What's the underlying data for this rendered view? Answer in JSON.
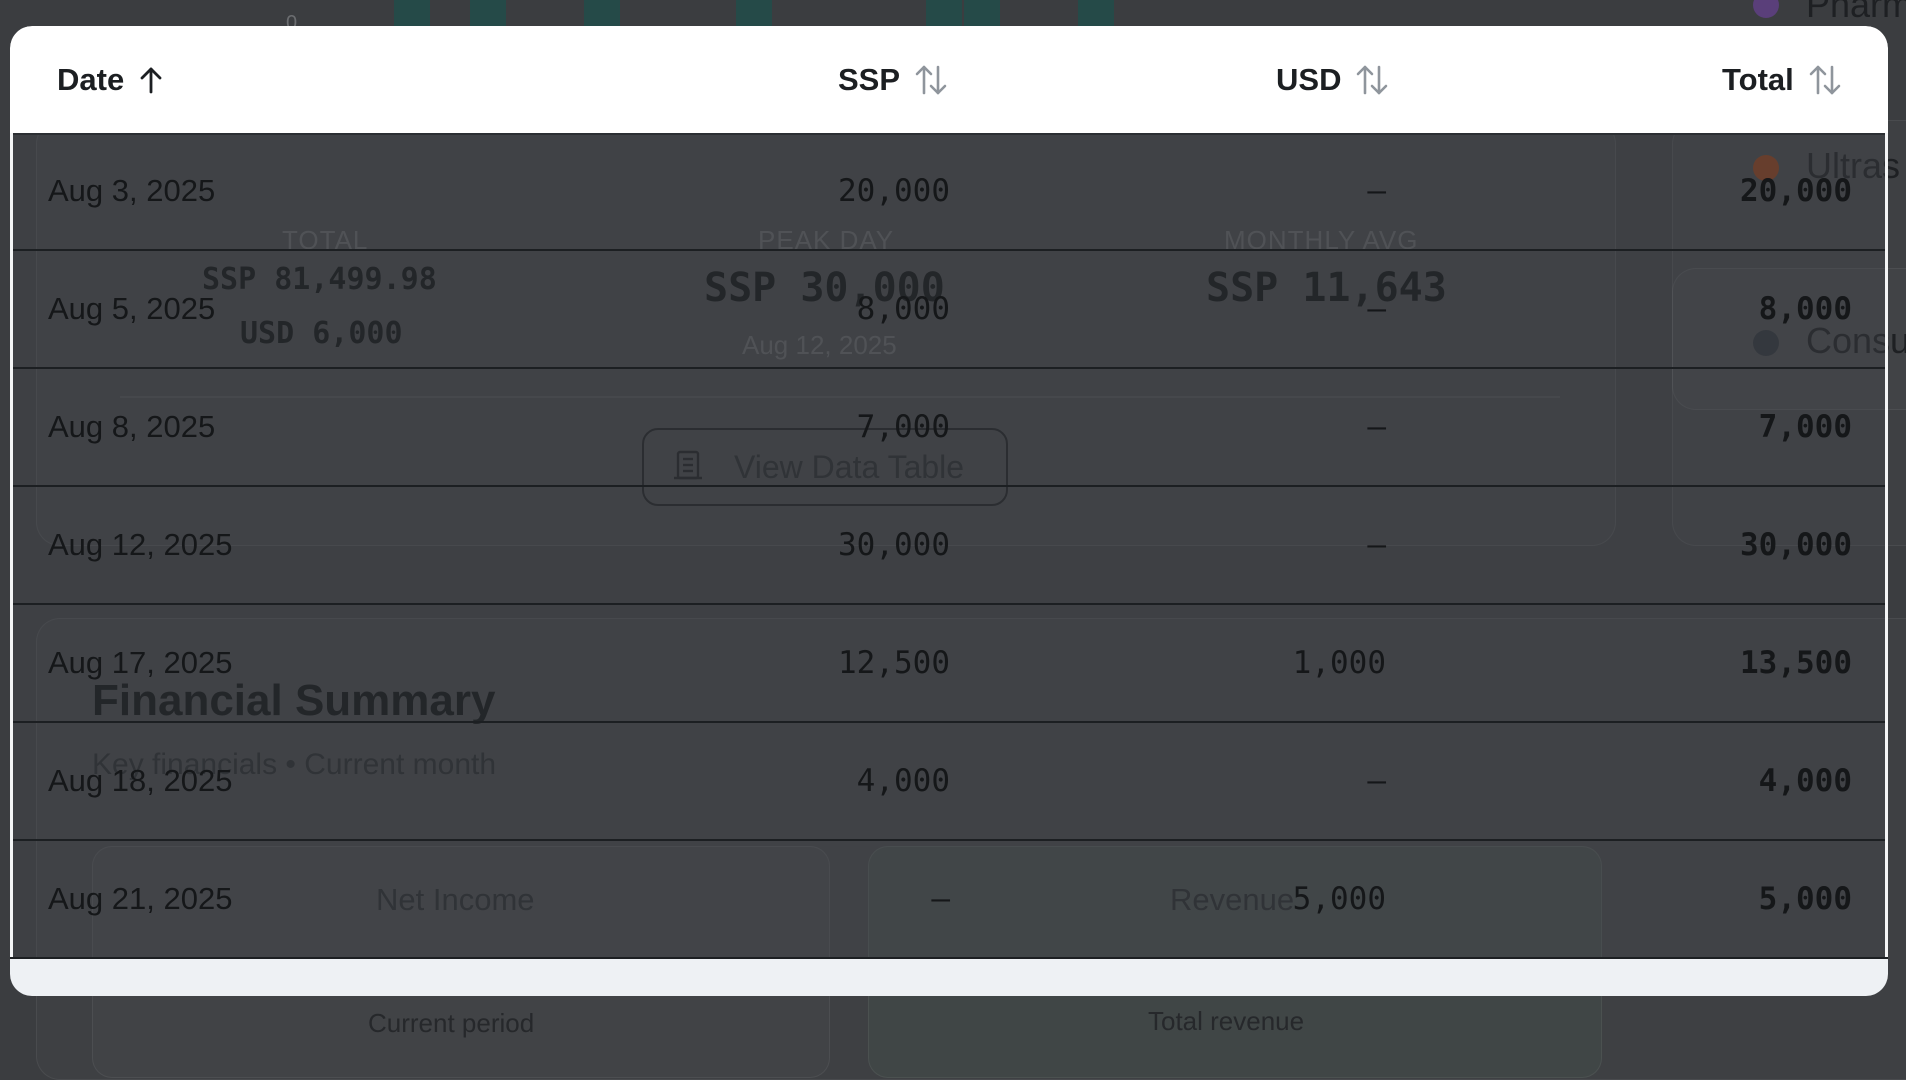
{
  "background": {
    "stats": {
      "total_label": "TOTAL",
      "total_ssp": "SSP 81,499.98",
      "total_usd": "USD 6,000",
      "peak_label": "PEAK DAY",
      "peak_value": "SSP 30,000",
      "peak_date": "Aug 12, 2025",
      "avg_label": "MONTHLY AVG",
      "avg_value": "SSP 11,643"
    },
    "view_table_button": "View Data Table",
    "summary_title": "Financial Summary",
    "summary_subtitle": "Key financials • Current month",
    "net_income_label": "Net Income",
    "revenue_label": "Revenue",
    "current_period": "Current period",
    "total_revenue": "Total revenue",
    "legend": {
      "ultrasound": "Ultras",
      "consultation": "Consu",
      "pharmacy": "Pharm"
    },
    "axis_zero": "0"
  },
  "table": {
    "headers": {
      "date": "Date",
      "ssp": "SSP",
      "usd": "USD",
      "total": "Total"
    },
    "rows": [
      {
        "date": "Aug 3, 2025",
        "ssp": "20,000",
        "usd": "—",
        "total": "20,000"
      },
      {
        "date": "Aug 5, 2025",
        "ssp": "8,000",
        "usd": "—",
        "total": "8,000"
      },
      {
        "date": "Aug 8, 2025",
        "ssp": "7,000",
        "usd": "—",
        "total": "7,000"
      },
      {
        "date": "Aug 12, 2025",
        "ssp": "30,000",
        "usd": "—",
        "total": "30,000"
      },
      {
        "date": "Aug 17, 2025",
        "ssp": "12,500",
        "usd": "1,000",
        "total": "13,500"
      },
      {
        "date": "Aug 18, 2025",
        "ssp": "4,000",
        "usd": "—",
        "total": "4,000"
      },
      {
        "date": "Aug 21, 2025",
        "ssp": "—",
        "usd": "5,000",
        "total": "5,000"
      }
    ]
  },
  "colors": {
    "header_bg": "#ffffff",
    "overlay": "#3b3d40",
    "accent_green": "#2f6b4a",
    "ultrasound_dot": "#7a3a1c",
    "consultation_dot": "#2c3137",
    "pharmacy_dot": "#5a3f7a"
  }
}
